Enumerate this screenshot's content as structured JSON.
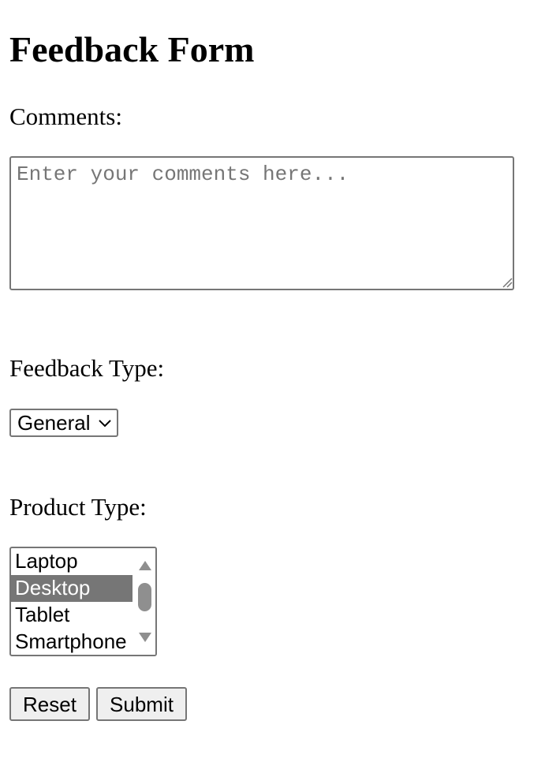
{
  "form": {
    "title": "Feedback Form",
    "comments": {
      "label": "Comments:",
      "value": "",
      "placeholder": "Enter your comments here..."
    },
    "feedback_type": {
      "label": "Feedback Type:",
      "selected": "General"
    },
    "product_type": {
      "label": "Product Type:",
      "options": [
        "Laptop",
        "Desktop",
        "Tablet",
        "Smartphone"
      ],
      "selected_index": 1
    },
    "buttons": {
      "reset_label": "Reset",
      "submit_label": "Submit"
    }
  },
  "colors": {
    "border": "#767676",
    "selected_option_bg": "#767676",
    "button_bg": "#efefef",
    "scrollbar_thumb": "#8f8f8f"
  },
  "icons": {
    "select_chevron": "chevron-down-icon",
    "scroll_up": "scroll-up-arrow-icon",
    "scroll_down": "scroll-down-arrow-icon",
    "resize_grip": "resize-grip-icon"
  }
}
